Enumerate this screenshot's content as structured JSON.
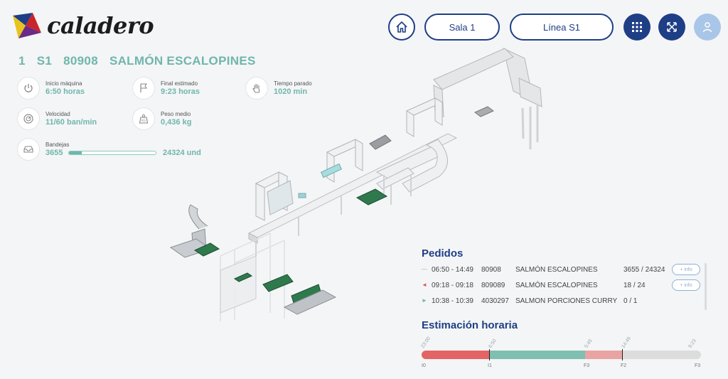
{
  "brand": {
    "name": "caladero"
  },
  "nav": {
    "room": "Sala 1",
    "line": "Línea S1"
  },
  "header": {
    "line_no": "1",
    "line_code": "S1",
    "order_no": "80908",
    "product": "SALMÓN ESCALOPINES"
  },
  "stats": {
    "start": {
      "label": "Inicio máquina",
      "value": "6:50 horas"
    },
    "end": {
      "label": "Final estimado",
      "value": "9:23 horas"
    },
    "stopped": {
      "label": "Tiempo parado",
      "value": "1020 min"
    },
    "speed": {
      "label": "Velocidad",
      "value": "11/60 ban/min"
    },
    "weight": {
      "label": "Peso medio",
      "value": "0,436 kg"
    },
    "trays": {
      "label": "Bandejas",
      "value": "3655",
      "target": "24324 und",
      "progress": 0.15
    }
  },
  "orders": {
    "title": "Pedidos",
    "info_label": "+ info",
    "rows": [
      {
        "marker": "—",
        "marker_color": "#aaaaaa",
        "time": "06:50 - 14:49",
        "code": "80908",
        "product": "SALMÓN ESCALOPINES",
        "qty": "3655 / 24324",
        "info": true
      },
      {
        "marker": "◄",
        "marker_color": "#e05a5a",
        "time": "09:18 - 09:18",
        "code": "809089",
        "product": "SALMÓN ESCALOPINES",
        "qty": "18 / 24",
        "info": true
      },
      {
        "marker": "►",
        "marker_color": "#6fb6ad",
        "time": "10:38 - 10:39",
        "code": "4030297",
        "product": "SALMON PORCIONES CURRY",
        "qty": "0 / 1",
        "info": false
      }
    ]
  },
  "timeline": {
    "title": "Estimación horaria",
    "times": [
      "23:00",
      "6:50",
      "5:45",
      "14:49",
      "9:23"
    ],
    "labels": [
      "I0",
      "I1",
      "F3",
      "F2",
      "F3"
    ],
    "colors": {
      "stopped": "#e36464",
      "running": "#7fbfb1",
      "light": "#eaa3a3",
      "pending": "#dcdcdc"
    }
  }
}
